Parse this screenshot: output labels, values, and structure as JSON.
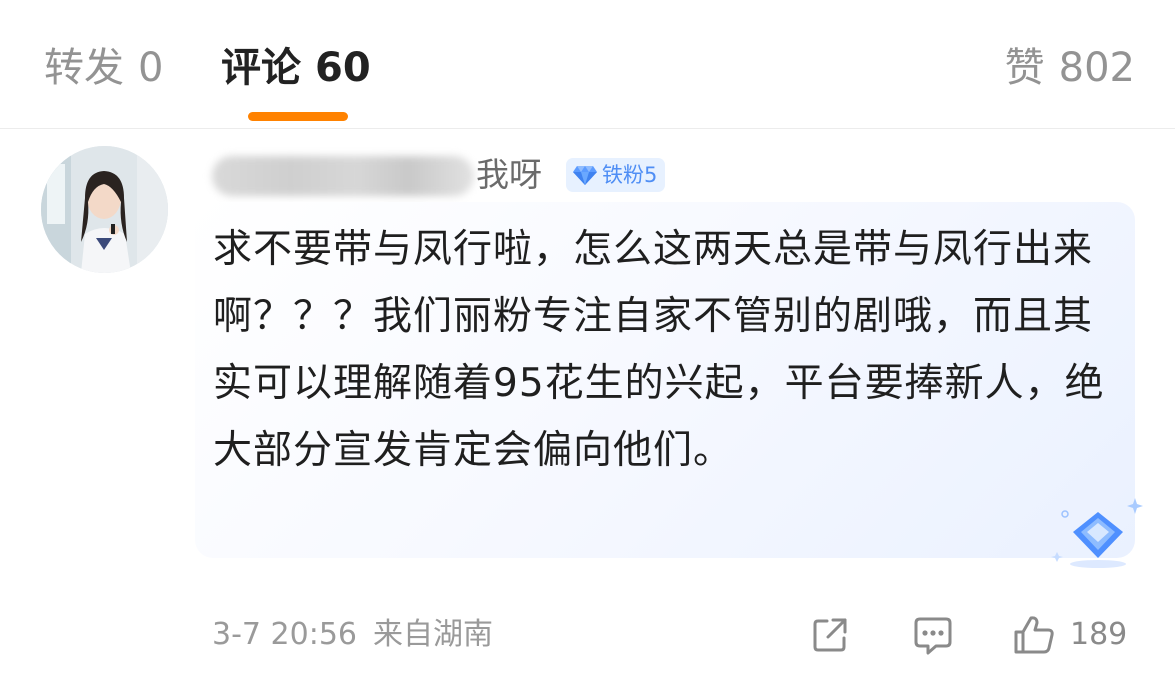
{
  "tabs": {
    "repost": {
      "label": "转发",
      "count": "0"
    },
    "comments": {
      "label": "评论",
      "count": "60"
    },
    "likes": {
      "label": "赞",
      "count": "802"
    }
  },
  "comment": {
    "username_visible": "我呀",
    "badge": {
      "label": "铁粉5",
      "icon": "diamond-icon"
    },
    "text": "求不要带与凤行啦，怎么这两天总是带与凤行出来啊？？？我们丽粉专注自家不管别的剧哦，而且其实可以理解随着95花生的兴起，平台要捧新人，绝大部分宣发肯定会偏向他们。",
    "timestamp": "3-7 20:56",
    "location": "来自湖南",
    "like_count": "189"
  },
  "icons": [
    "share-icon",
    "reply-icon",
    "thumbs-up-icon"
  ],
  "colors": {
    "accent": "#ff8200",
    "badge_blue": "#4f8ef5",
    "muted_text": "#939393"
  }
}
